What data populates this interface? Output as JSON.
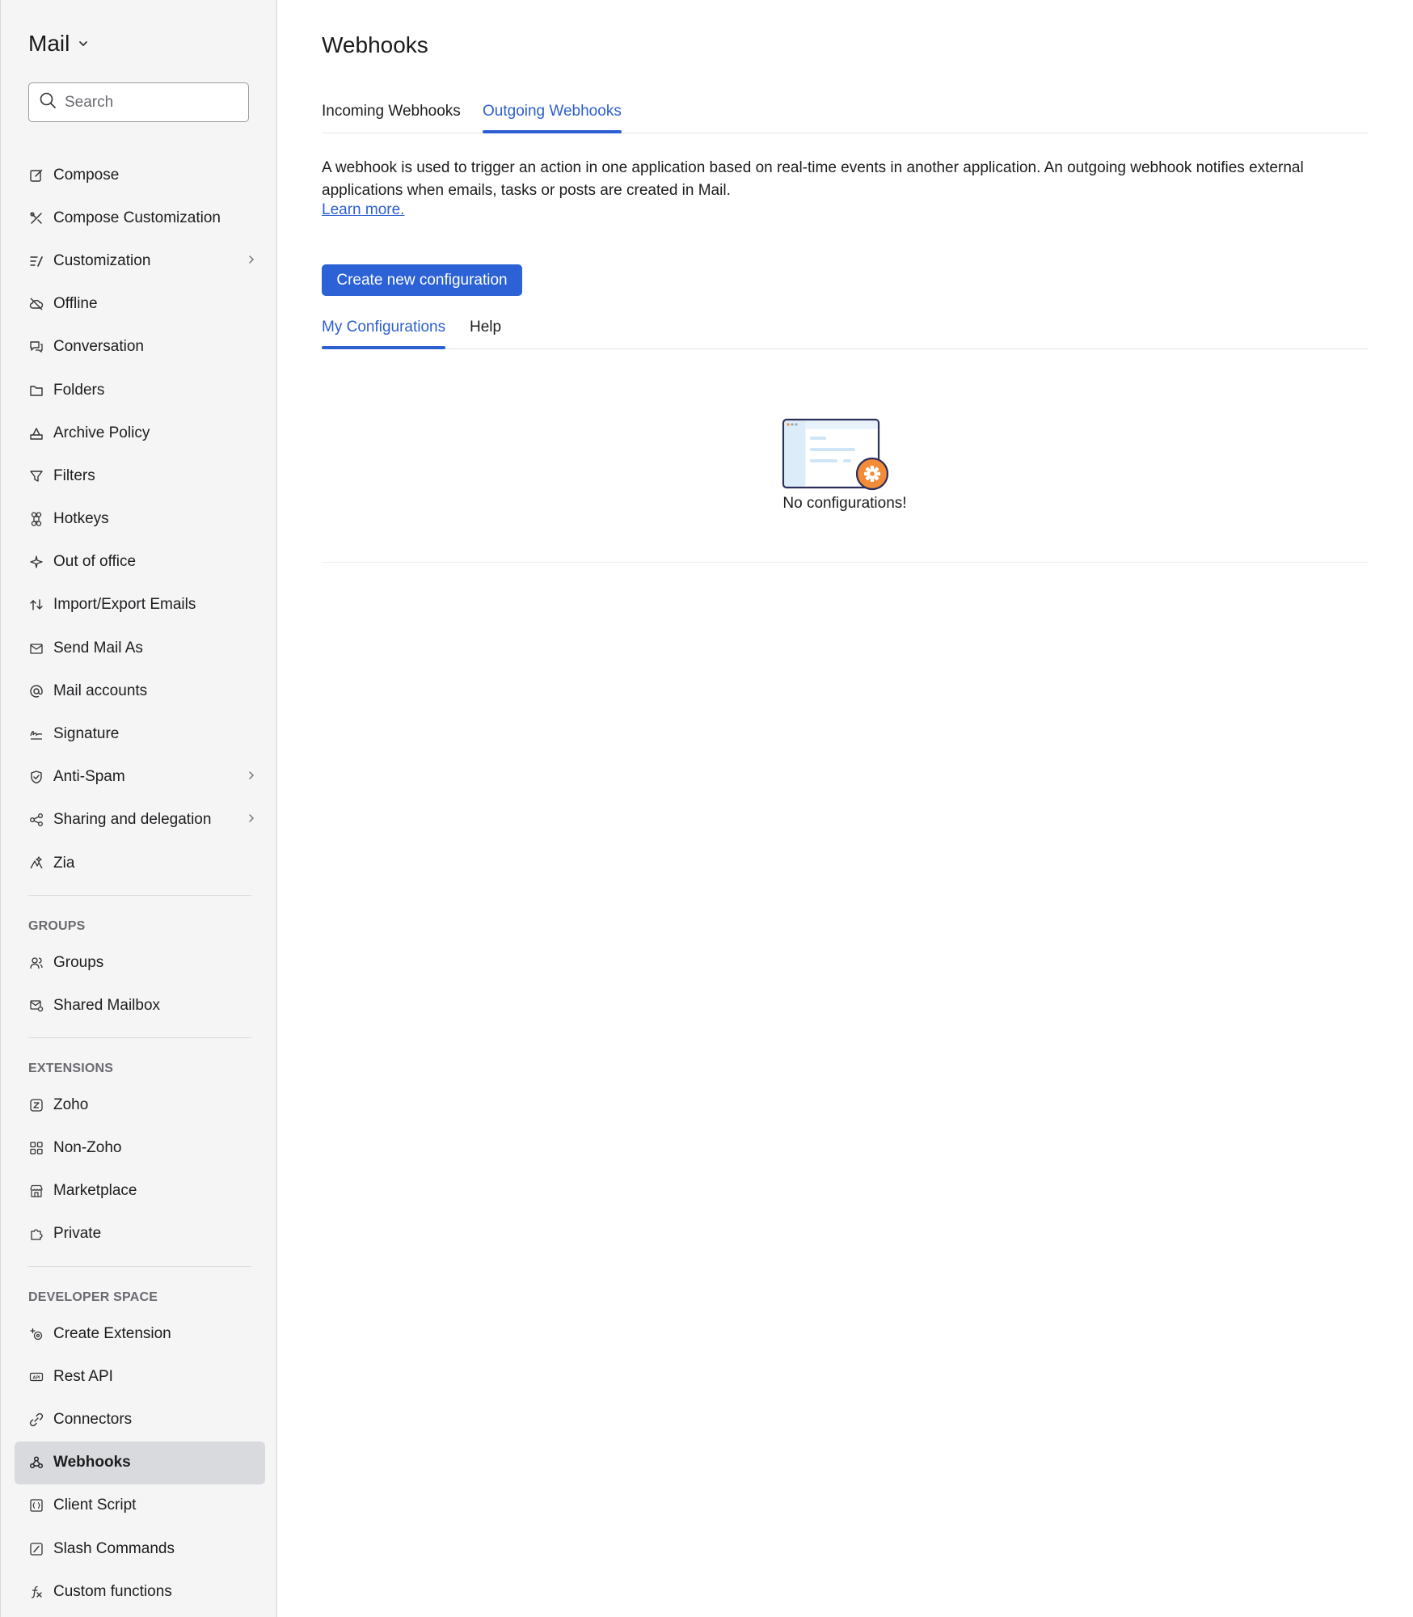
{
  "sidebar": {
    "app_title": "Mail",
    "search_placeholder": "Search",
    "items": [
      {
        "label": "Compose",
        "icon": "compose-icon"
      },
      {
        "label": "Compose Customization",
        "icon": "compose-customization-icon"
      },
      {
        "label": "Customization",
        "icon": "customization-icon",
        "has_submenu": true
      },
      {
        "label": "Offline",
        "icon": "offline-icon"
      },
      {
        "label": "Conversation",
        "icon": "conversation-icon"
      },
      {
        "label": "Folders",
        "icon": "folder-icon"
      },
      {
        "label": "Archive Policy",
        "icon": "archive-icon"
      },
      {
        "label": "Filters",
        "icon": "filter-icon"
      },
      {
        "label": "Hotkeys",
        "icon": "command-key-icon"
      },
      {
        "label": "Out of office",
        "icon": "out-of-office-icon"
      },
      {
        "label": "Import/Export Emails",
        "icon": "import-export-icon"
      },
      {
        "label": "Send Mail As",
        "icon": "send-mail-as-icon"
      },
      {
        "label": "Mail accounts",
        "icon": "at-sign-icon"
      },
      {
        "label": "Signature",
        "icon": "signature-icon"
      },
      {
        "label": "Anti-Spam",
        "icon": "shield-check-icon",
        "has_submenu": true
      },
      {
        "label": "Sharing and delegation",
        "icon": "share-icon",
        "has_submenu": true
      },
      {
        "label": "Zia",
        "icon": "zia-icon"
      }
    ],
    "groups": {
      "header": "GROUPS",
      "items": [
        {
          "label": "Groups",
          "icon": "groups-icon"
        },
        {
          "label": "Shared Mailbox",
          "icon": "shared-mailbox-icon"
        }
      ]
    },
    "extensions": {
      "header": "EXTENSIONS",
      "items": [
        {
          "label": "Zoho",
          "icon": "zoho-icon"
        },
        {
          "label": "Non-Zoho",
          "icon": "grid-icon"
        },
        {
          "label": "Marketplace",
          "icon": "store-icon"
        },
        {
          "label": "Private",
          "icon": "puzzle-icon"
        }
      ]
    },
    "developer": {
      "header": "DEVELOPER SPACE",
      "items": [
        {
          "label": "Create Extension",
          "icon": "create-extension-icon"
        },
        {
          "label": "Rest API",
          "icon": "api-icon"
        },
        {
          "label": "Connectors",
          "icon": "connector-icon"
        },
        {
          "label": "Webhooks",
          "icon": "webhook-icon",
          "active": true
        },
        {
          "label": "Client Script",
          "icon": "client-script-icon"
        },
        {
          "label": "Slash Commands",
          "icon": "slash-command-icon"
        },
        {
          "label": "Custom functions",
          "icon": "function-icon"
        }
      ]
    }
  },
  "main": {
    "title": "Webhooks",
    "tabs": [
      {
        "label": "Incoming Webhooks",
        "active": false
      },
      {
        "label": "Outgoing Webhooks",
        "active": true
      }
    ],
    "description": "A webhook is used to trigger an action in one application based on real-time events in another application. An outgoing webhook notifies external applications when emails, tasks or posts are created in Mail.",
    "learn_more": "Learn more.",
    "create_button": "Create new configuration",
    "sub_tabs": [
      {
        "label": "My Configurations",
        "active": true
      },
      {
        "label": "Help",
        "active": false
      }
    ],
    "empty_state": "No configurations!"
  },
  "colors": {
    "accent": "#2c5fcf",
    "button": "#2c62d6",
    "sidebar_bg": "#f5f5f6",
    "active_item_bg": "#d9dadd",
    "illustration_orange": "#f28c38",
    "illustration_outline": "#2a2f5c"
  }
}
